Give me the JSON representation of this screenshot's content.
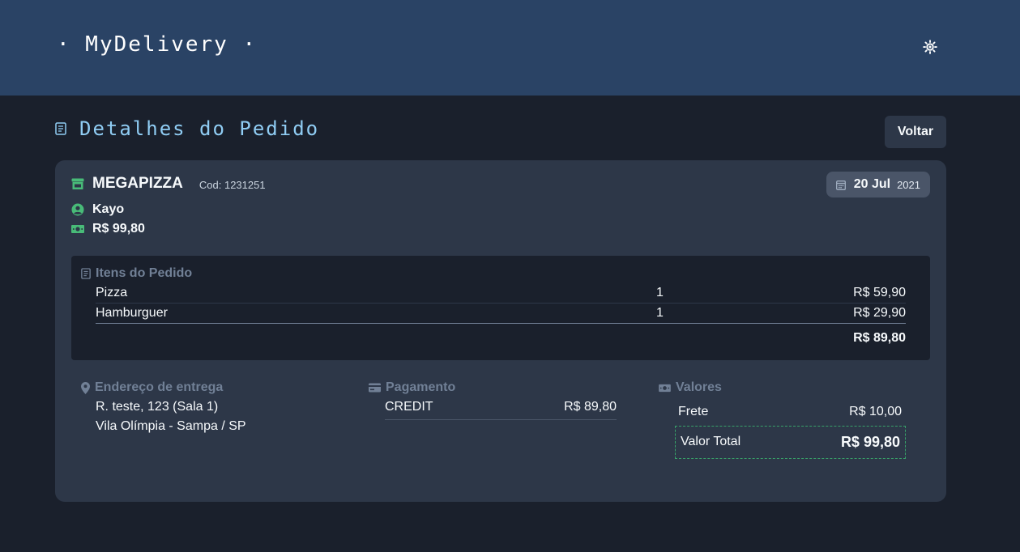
{
  "header": {
    "brand": "· MyDelivery ·",
    "theme_icon": "sun-icon"
  },
  "page": {
    "title": "Detalhes do Pedido",
    "back_label": "Voltar"
  },
  "order": {
    "store_name": "MEGAPIZZA",
    "code": "Cod: 1231251",
    "date_day": "20 Jul",
    "date_year": "2021",
    "customer": "Kayo",
    "amount": "R$ 99,80"
  },
  "items": {
    "header": "Itens do Pedido",
    "rows": [
      {
        "name": "Pizza",
        "qty": "1",
        "price": "R$ 59,90"
      },
      {
        "name": "Hamburguer",
        "qty": "1",
        "price": "R$ 29,90"
      }
    ],
    "total": "R$ 89,80"
  },
  "address": {
    "header": "Endereço de entrega",
    "line1": "R. teste, 123 (Sala 1)",
    "line2": "Vila Olímpia - Sampa / SP"
  },
  "payment": {
    "header": "Pagamento",
    "method": "CREDIT",
    "amount": "R$ 89,80"
  },
  "values": {
    "header": "Valores",
    "frete_label": "Frete",
    "frete_value": "R$ 10,00",
    "total_label": "Valor Total",
    "total_value": "R$ 99,80"
  },
  "colors": {
    "header_bg": "#2a4365",
    "page_bg": "#1a202c",
    "card_bg": "#2d3748",
    "title": "#90cdf4",
    "accent_green": "#48bb78"
  }
}
